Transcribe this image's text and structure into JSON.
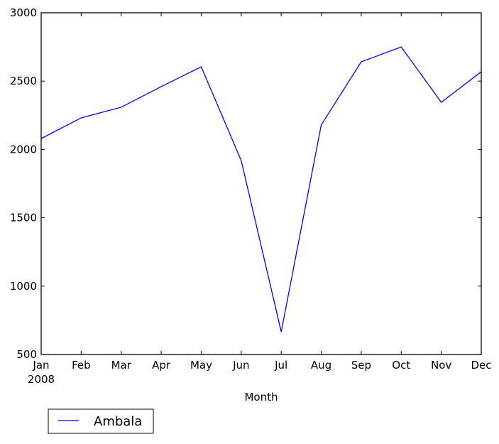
{
  "chart_data": {
    "type": "line",
    "title": "",
    "xlabel": "Month",
    "ylabel": "",
    "categories": [
      "Jan",
      "Feb",
      "Mar",
      "Apr",
      "May",
      "Jun",
      "Jul",
      "Aug",
      "Sep",
      "Oct",
      "Nov",
      "Dec"
    ],
    "x_tick_labels": [
      "Jan\n2008",
      "Feb",
      "Mar",
      "Apr",
      "May",
      "Jun",
      "Jul",
      "Aug",
      "Sep",
      "Oct",
      "Nov",
      "Dec"
    ],
    "x_first_tick_year": "2008",
    "y_ticks": [
      500,
      1000,
      1500,
      2000,
      2500,
      3000
    ],
    "ylim": [
      500,
      3000
    ],
    "grid": false,
    "legend": {
      "placement": "below-left",
      "entries": [
        "Ambala"
      ]
    },
    "series": [
      {
        "name": "Ambala",
        "color": "#0000ff",
        "values": [
          2080,
          2231,
          2309,
          2460,
          2605,
          1919,
          666,
          2179,
          2641,
          2750,
          2345,
          2569
        ]
      }
    ]
  }
}
